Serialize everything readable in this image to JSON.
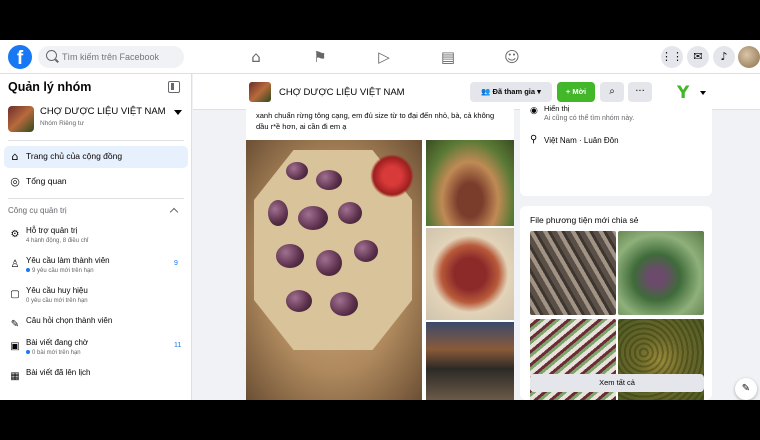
{
  "topbar": {
    "logo": "f",
    "search_placeholder": "Tìm kiếm trên Facebook",
    "nav_icons": [
      "home-icon",
      "flag-icon",
      "video-icon",
      "marketplace-icon",
      "groups-icon"
    ],
    "right_icons": [
      "menu-grid-icon",
      "messenger-icon",
      "notifications-icon"
    ]
  },
  "sidebar": {
    "title": "Quản lý nhóm",
    "group": {
      "name": "CHỢ DƯỢC LIỆU VIỆT NAM",
      "privacy": "Nhóm Riêng tư"
    },
    "nav": [
      {
        "label": "Trang chủ của cộng đồng",
        "icon": "home-icon",
        "active": true
      },
      {
        "label": "Tổng quan",
        "icon": "overview-icon",
        "active": false
      }
    ],
    "tools_header": "Công cụ quản trị",
    "tools": [
      {
        "label": "Hỗ trợ quản trị",
        "sub": "4 hành động, 8 điều chỉ",
        "icon": "admin-assist-icon",
        "dot": false,
        "count": ""
      },
      {
        "label": "Yêu cầu làm thành viên",
        "sub": "9 yêu cầu mới trên hạn",
        "icon": "member-request-icon",
        "dot": true,
        "count": "9"
      },
      {
        "label": "Yêu cầu huy hiệu",
        "sub": "0 yêu cầu mới trên hạn",
        "icon": "badge-icon",
        "dot": false,
        "count": ""
      },
      {
        "label": "Câu hỏi chọn thành viên",
        "sub": "",
        "icon": "question-icon",
        "dot": false,
        "count": ""
      },
      {
        "label": "Bài viết đang chờ",
        "sub": "0 bài mới trên hạn",
        "icon": "pending-post-icon",
        "dot": true,
        "count": "11"
      },
      {
        "label": "Bài viết đã lên lịch",
        "sub": "",
        "icon": "scheduled-icon",
        "dot": false,
        "count": ""
      }
    ]
  },
  "group_header": {
    "name": "CHỢ DƯỢC LIỆU VIỆT NAM",
    "joined_label": "Đã tham gia",
    "invite_label": "+ Mời",
    "search_icon": "search-icon",
    "more_icon": "more-icon"
  },
  "post": {
    "text": "xanh chuẩn rừng tông cạng, em đủ size từ to đại đến nhỏ, bà, cả không dầu r*ề hơn, ai cần đi em ạ"
  },
  "about": {
    "visibility_title": "Hiển thị",
    "visibility_desc": "Ai cũng có thể tìm nhóm này.",
    "location": "Việt Nam · Luân Đôn"
  },
  "media": {
    "header": "File phương tiện mới chia sẻ",
    "see_all": "Xem tất cả"
  },
  "colors": {
    "brand": "#1877f2",
    "invite": "#42b72a",
    "bg": "#f0f2f5"
  }
}
